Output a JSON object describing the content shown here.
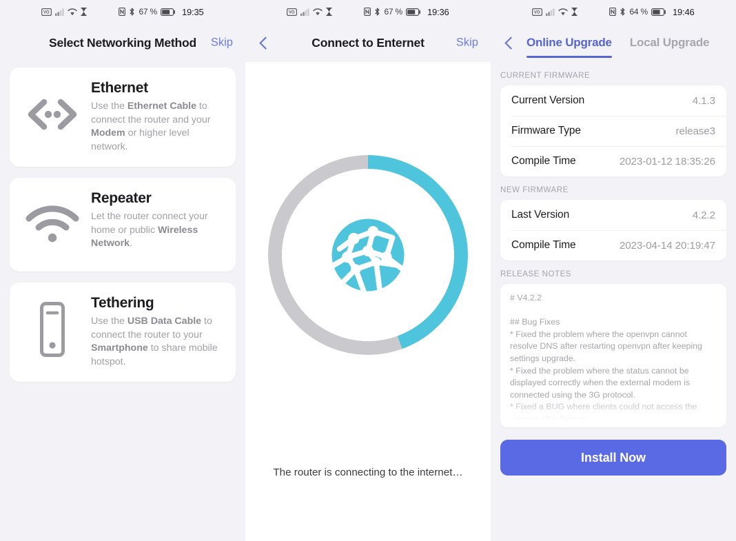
{
  "colors": {
    "page_bg": "#f2f2f7",
    "card_bg": "#ffffff",
    "accent_blue": "#5a6ae4",
    "link_blue": "#6b7ee0",
    "spinner_cyan": "#4ec5dc",
    "spinner_track": "#c9c9ce",
    "muted_text": "#a0a0a8",
    "title_text": "#1b1b20"
  },
  "panels": {
    "left": {
      "statusbar": {
        "icons_left": [
          "vowifi-icon",
          "signal-bars-icon",
          "wifi-icon",
          "hourglass-icon"
        ],
        "icons_right": [
          "nfc-icon",
          "bluetooth-icon"
        ],
        "battery": "67 %",
        "battery_icon": "battery-icon",
        "time": "19:35"
      },
      "nav": {
        "title": "Select Networking Method",
        "skip_label": "Skip",
        "back_visible": false
      },
      "cards": [
        {
          "icon": "ethernet-arrows-icon",
          "title": "Ethernet",
          "desc_parts": [
            {
              "t": "Use the ",
              "b": false
            },
            {
              "t": "Ethernet Cable",
              "b": true
            },
            {
              "t": " to connect the router and your ",
              "b": false
            },
            {
              "t": "Modem",
              "b": true
            },
            {
              "t": " or higher level network.",
              "b": false
            }
          ]
        },
        {
          "icon": "wifi-repeater-icon",
          "title": "Repeater",
          "desc_parts": [
            {
              "t": "Let the router connect your home or public ",
              "b": false
            },
            {
              "t": "Wireless Network",
              "b": true
            },
            {
              "t": ".",
              "b": false
            }
          ]
        },
        {
          "icon": "smartphone-icon",
          "title": "Tethering",
          "desc_parts": [
            {
              "t": "Use the ",
              "b": false
            },
            {
              "t": "USB Data Cable",
              "b": true
            },
            {
              "t": " to connect the router to your ",
              "b": false
            },
            {
              "t": "Smartphone",
              "b": true
            },
            {
              "t": " to share mobile hotspot.",
              "b": false
            }
          ]
        }
      ]
    },
    "middle": {
      "statusbar": {
        "battery": "67 %",
        "time": "19:36"
      },
      "nav": {
        "title": "Connect to Enternet",
        "skip_label": "Skip",
        "back_visible": true
      },
      "spinner": {
        "icon": "globe-network-icon",
        "progress_degrees": 160,
        "arc_color": "#4ec5dc",
        "track_color": "#c9c9ce"
      },
      "status_text": "The router is connecting to the internet…"
    },
    "right": {
      "statusbar": {
        "battery": "64 %",
        "time": "19:46"
      },
      "nav": {
        "back_visible": true,
        "tabs": [
          {
            "label": "Online Upgrade",
            "active": true
          },
          {
            "label": "Local Upgrade",
            "active": false
          }
        ]
      },
      "sections": [
        {
          "label": "CURRENT FIRMWARE",
          "rows": [
            {
              "key": "Current Version",
              "value": "4.1.3"
            },
            {
              "key": "Firmware Type",
              "value": "release3"
            },
            {
              "key": "Compile Time",
              "value": "2023-01-12 18:35:26"
            }
          ]
        },
        {
          "label": "NEW FIRMWARE",
          "rows": [
            {
              "key": "Last Version",
              "value": "4.2.2"
            },
            {
              "key": "Compile Time",
              "value": "2023-04-14 20:19:47"
            }
          ]
        }
      ],
      "release_notes": {
        "label": "RELEASE NOTES",
        "text": "# V4.2.2\n\n## Bug Fixes\n* Fixed the problem where the openvpn cannot resolve DNS after restarting openvpn after keeping settings upgrade.\n* Fixed the problem where the status cannot be displayed correctly when the external modem is connected using the 3G protocol.\n* Fixed a BUG where clients could not access the internet after failover.\n* Fixed some UI display exceptions.\n\n## Software Upgrade"
      },
      "install_button": "Install Now"
    }
  }
}
